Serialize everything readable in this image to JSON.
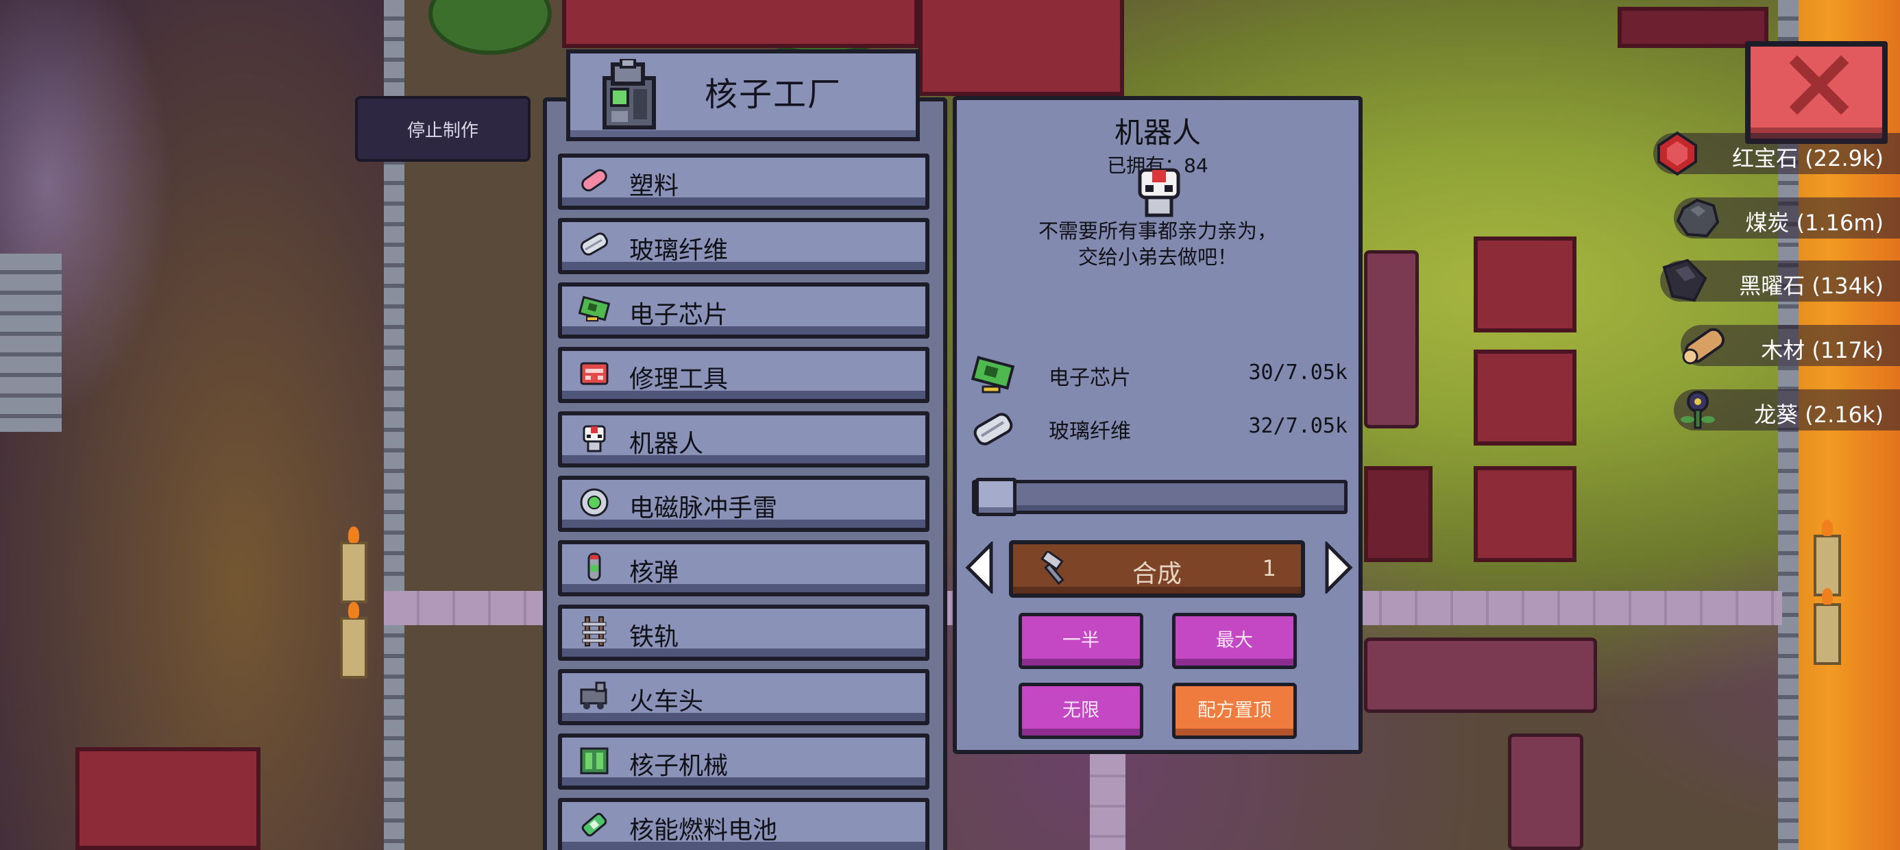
{
  "factory": {
    "title": "核子工厂",
    "stop_label": "停止制作"
  },
  "recipes": [
    {
      "label": "塑料",
      "icon": "plastic-icon"
    },
    {
      "label": "玻璃纤维",
      "icon": "fiberglass-icon"
    },
    {
      "label": "电子芯片",
      "icon": "microchip-icon"
    },
    {
      "label": "修理工具",
      "icon": "repair-tools-icon"
    },
    {
      "label": "机器人",
      "icon": "robot-icon"
    },
    {
      "label": "电磁脉冲手雷",
      "icon": "emp-grenade-icon"
    },
    {
      "label": "核弹",
      "icon": "nuke-icon"
    },
    {
      "label": "铁轨",
      "icon": "rail-icon"
    },
    {
      "label": "火车头",
      "icon": "locomotive-icon"
    },
    {
      "label": "核子机械",
      "icon": "nuclear-machine-icon"
    },
    {
      "label": "核能燃料电池",
      "icon": "fuel-cell-icon"
    }
  ],
  "detail": {
    "title": "机器人",
    "owned": "已拥有：84",
    "description_line1": "不需要所有事都亲力亲为，",
    "description_line2": "交给小弟去做吧！",
    "ingredients": [
      {
        "name": "电子芯片",
        "amount": "30/7.05k",
        "icon": "microchip-icon"
      },
      {
        "name": "玻璃纤维",
        "amount": "32/7.05k",
        "icon": "fiberglass-icon"
      }
    ],
    "slider_fraction": 0,
    "craft_label": "合成",
    "craft_count": "1",
    "half_label": "一半",
    "max_label": "最大",
    "infinite_label": "无限",
    "pin_label": "配方置顶"
  },
  "resources": [
    {
      "label": "红宝石 (22.9k)",
      "icon": "ruby-icon"
    },
    {
      "label": "煤炭 (1.16m)",
      "icon": "coal-icon"
    },
    {
      "label": "黑曜石 (134k)",
      "icon": "obsidian-icon"
    },
    {
      "label": "木材 (117k)",
      "icon": "wood-icon"
    },
    {
      "label": "龙葵 (2.16k)",
      "icon": "nightshade-icon"
    }
  ],
  "colors": {
    "panel": "#838aaf",
    "item": "#8a92b8",
    "outline": "#1d1d29",
    "craft_button": "#7d4427",
    "pink_button": "#c447c4",
    "orange_button": "#ef7b3e",
    "close_button": "#e25a5d"
  }
}
